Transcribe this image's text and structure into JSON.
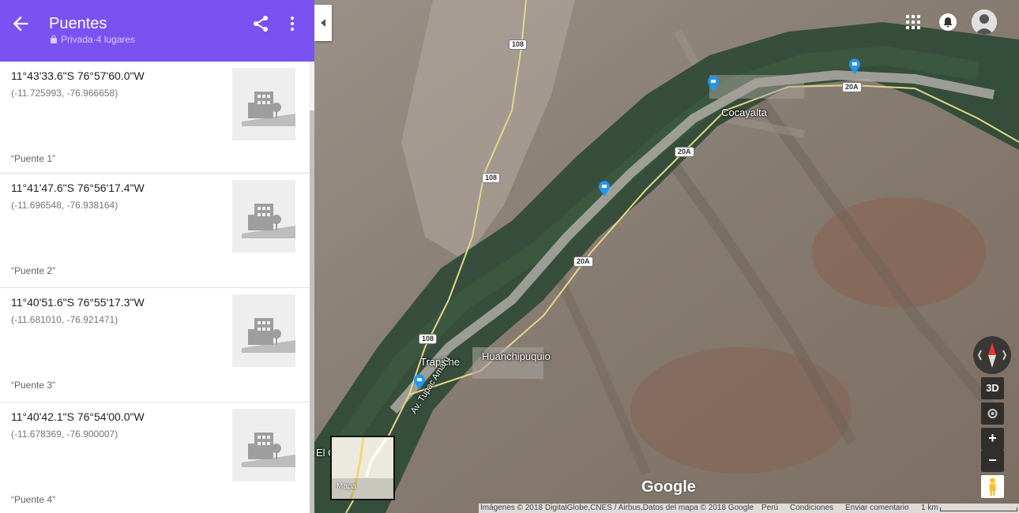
{
  "header": {
    "title": "Puentes",
    "privacy_label": "Privada",
    "separator": "·",
    "places_count": "4 lugares",
    "accent_color": "#7a52f2"
  },
  "places": [
    {
      "coords": "11°43'33.6\"S 76°57'60.0\"W",
      "decimal": "(-11.725993, -76.966658)",
      "note": "“Puente 1”"
    },
    {
      "coords": "11°41'47.6\"S 76°56'17.4\"W",
      "decimal": "(-11.696548, -76.938164)",
      "note": "“Puente 2”"
    },
    {
      "coords": "11°40'51.6\"S 76°55'17.3\"W",
      "decimal": "(-11.681010, -76.921471)",
      "note": "“Puente 3”"
    },
    {
      "coords": "11°40'42.1\"S 76°54'00.0\"W",
      "decimal": "(-11.678369, -76.900007)",
      "note": "“Puente 4”"
    }
  ],
  "map": {
    "towns": {
      "cocayalta": "Cocayalta",
      "trapiche": "Trapiche",
      "huanchipuquio": "Huanchipuquio",
      "el_partial": "El C",
      "street": "Av. Tupac Amaru"
    },
    "routes": {
      "r108": "108",
      "r20a": "20A"
    },
    "controls": {
      "three_d": "3D",
      "zoom_in": "+",
      "zoom_out": "−"
    },
    "minimap_label": "Mapa",
    "logo": "Google",
    "attribution": {
      "imagery": "Imágenes © 2018 DigitalGlobe,CNES / Airbus,Datos del mapa © 2018 Google",
      "country": "Perú",
      "terms": "Condiciones",
      "feedback": "Enviar comentario",
      "scale": "1 km"
    }
  }
}
